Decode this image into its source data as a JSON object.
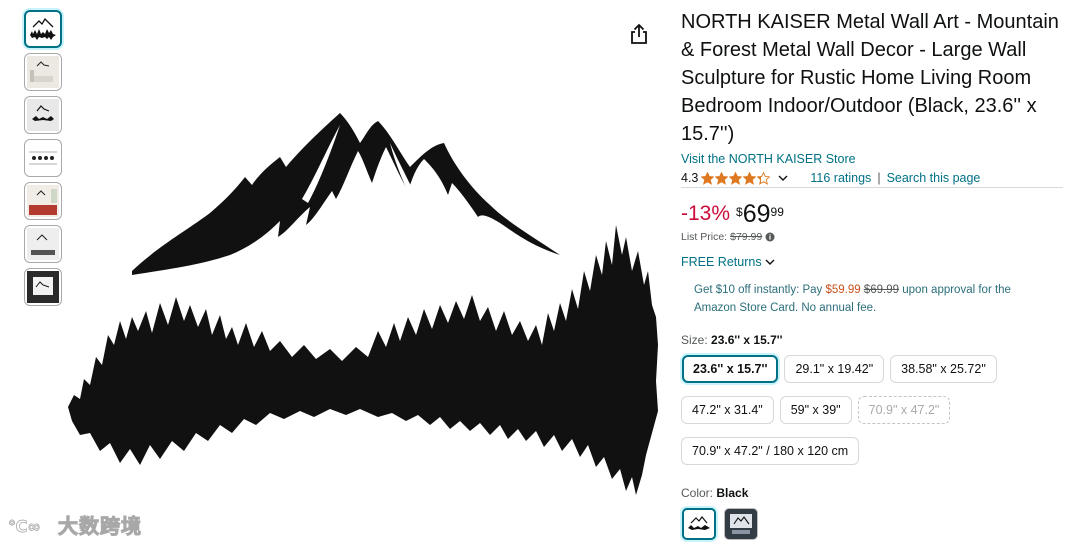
{
  "product": {
    "title": "NORTH KAISER Metal Wall Art - Mountain & Forest Metal Wall Decor - Large Wall Sculpture for Rustic Home Living Room Bedroom Indoor/Outdoor (Black, 23.6'' x 15.7'')",
    "store_link": "Visit the NORTH KAISER Store",
    "rating": "4.3",
    "rating_value": 4.3,
    "ratings_count": "116 ratings",
    "separator": "|",
    "search_page": "Search this page"
  },
  "pricing": {
    "discount": "-13%",
    "currency": "$",
    "whole": "69",
    "fraction": "99",
    "list_price_label": "List Price:",
    "list_price": "$79.99",
    "free_returns": "FREE Returns"
  },
  "card_offer": {
    "prefix": "Get $10 off instantly: Pay",
    "new_price": "$59.99",
    "old_price": "$69.99",
    "suffix": "upon approval for the Amazon Store Card. No annual fee."
  },
  "size": {
    "label": "Size:",
    "selected": "23.6'' x 15.7''",
    "options": [
      {
        "label": "23.6'' x 15.7''",
        "state": "selected"
      },
      {
        "label": "29.1\" x 19.42\"",
        "state": "available"
      },
      {
        "label": "38.58\" x 25.72\"",
        "state": "available"
      },
      {
        "label": "47.2\" x 31.4\"",
        "state": "available"
      },
      {
        "label": "59\" x 39\"",
        "state": "available"
      },
      {
        "label": "70.9\" x 47.2\"",
        "state": "unavailable"
      },
      {
        "label": "70.9\" x 47.2\" / 180 x 120 cm",
        "state": "available"
      }
    ]
  },
  "color": {
    "label": "Color:",
    "selected": "Black"
  },
  "watermark": {
    "text": "大数跨境"
  },
  "colors": {
    "link": "#007185",
    "discount": "#cc0c39",
    "star": "#de7921",
    "selected_border": "#007185"
  },
  "thumbnails": [
    "mountain-forest-art",
    "living-room-scene",
    "product-closeup",
    "multi-piece-set",
    "bedroom-scene",
    "wall-mounted",
    "dark-display"
  ]
}
